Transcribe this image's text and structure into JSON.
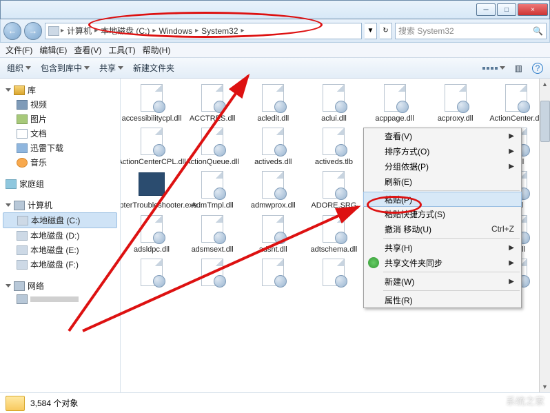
{
  "titlebar": {
    "min": "─",
    "max": "□",
    "close": "×"
  },
  "nav": {
    "back": "←",
    "fwd": "→"
  },
  "breadcrumbs": {
    "b0": "计算机",
    "b1": "本地磁盘 (C:)",
    "b2": "Windows",
    "b3": "System32"
  },
  "history": "▼",
  "refresh": "↻",
  "search": {
    "placeholder": "搜索 System32"
  },
  "menubar": {
    "file": "文件(F)",
    "edit": "编辑(E)",
    "view": "查看(V)",
    "tools": "工具(T)",
    "help": "帮助(H)"
  },
  "toolbar": {
    "organize": "组织",
    "include": "包含到库中",
    "share": "共享",
    "newfolder": "新建文件夹"
  },
  "sidebar": {
    "lib": "库",
    "video": "视频",
    "pictures": "图片",
    "documents": "文档",
    "downloads": "迅雷下载",
    "music": "音乐",
    "homegroup": "家庭组",
    "computer": "计算机",
    "drive_c": "本地磁盘 (C:)",
    "drive_d": "本地磁盘 (D:)",
    "drive_e": "本地磁盘 (E:)",
    "drive_f": "本地磁盘 (F:)",
    "network": "网络"
  },
  "files": {
    "r0c0": "accessibilitycpl.dll",
    "r0c1": "ACCTRES.dll",
    "r0c2": "acledit.dll",
    "r0c3": "aclui.dll",
    "r0c4": "acppage.dll",
    "r0c5": "acproxy.dll",
    "r0c6": "ActionCenter.dll",
    "r1c0": "ActionCenterCPL.dll",
    "r1c1": "ActionQueue.dll",
    "r1c2": "activeds.dll",
    "r1c3": "activeds.tlb",
    "r1c4": "",
    "r1c5": "",
    "r1c6": "ql.dll",
    "r2c0": "AdapterTroubleshooter.exe",
    "r2c1": "AdmTmpl.dll",
    "r2c2": "admwprox.dll",
    "r2c3": "ADORE.SRG",
    "r2c4": "",
    "r2c5": "",
    "r2c6": "p.dll",
    "r3c0": "adsldpc.dll",
    "r3c1": "adsmsext.dll",
    "r3c2": "adsnt.dll",
    "r3c3": "adtschema.dll",
    "r3c4": "",
    "r3c5": "",
    "r3c6": "he.dll"
  },
  "contextmenu": {
    "view": "查看(V)",
    "sort": "排序方式(O)",
    "groupby": "分组依据(P)",
    "refresh": "刷新(E)",
    "paste": "粘贴(P)",
    "pasteshortcut": "粘贴快捷方式(S)",
    "undo": "撤消 移动(U)",
    "undo_key": "Ctrl+Z",
    "share": "共享(H)",
    "sharesync": "共享文件夹同步",
    "new": "新建(W)",
    "properties": "属性(R)"
  },
  "status": {
    "count": "3,584 个对象"
  },
  "watermark": "系统之家"
}
